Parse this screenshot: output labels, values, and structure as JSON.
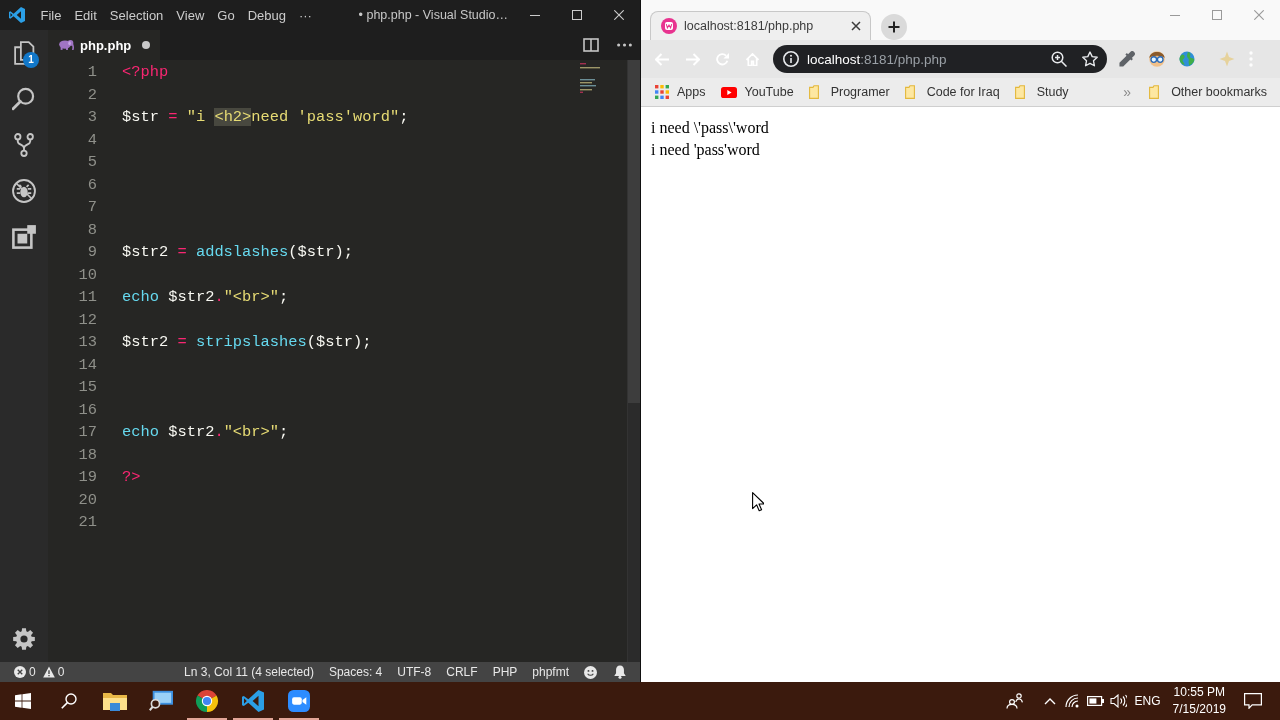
{
  "editor": {
    "title": "• php.php - Visual Studio…",
    "menu": [
      "File",
      "Edit",
      "Selection",
      "View",
      "Go",
      "Debug",
      "···"
    ],
    "explorer_badge": "1",
    "tab": {
      "label": "php.php",
      "modified": true
    },
    "lines": [
      {
        "number": "1",
        "tokens": [
          {
            "kind": "tag",
            "text": "<?php",
            "selected": false
          }
        ]
      },
      {
        "number": "2"
      },
      {
        "number": "3",
        "tokens": [
          {
            "kind": "variable",
            "text": "$str",
            "selected": false
          },
          {
            "kind": "operator",
            "text": " = ",
            "selected": false
          },
          {
            "kind": "string",
            "text": "\"i ",
            "selected": false
          },
          {
            "kind": "string",
            "text": "<h2>",
            "selected": true
          },
          {
            "kind": "string",
            "text": "need 'pass'word\"",
            "selected": false
          },
          {
            "kind": "punctuation",
            "text": ";",
            "selected": false
          }
        ]
      },
      {
        "number": "4"
      },
      {
        "number": "5"
      },
      {
        "number": "6"
      },
      {
        "number": "7"
      },
      {
        "number": "8"
      },
      {
        "number": "9",
        "tokens": [
          {
            "kind": "variable",
            "text": "$str2",
            "selected": false
          },
          {
            "kind": "operator",
            "text": " = ",
            "selected": false
          },
          {
            "kind": "function",
            "text": "addslashes",
            "selected": false
          },
          {
            "kind": "punctuation",
            "text": "($str);",
            "selected": false
          }
        ]
      },
      {
        "number": "10"
      },
      {
        "number": "11",
        "tokens": [
          {
            "kind": "keyword",
            "text": "echo",
            "selected": false
          },
          {
            "kind": "variable",
            "text": " $str2",
            "selected": false
          },
          {
            "kind": "operator",
            "text": ".",
            "selected": false
          },
          {
            "kind": "string",
            "text": "\"<br>\"",
            "selected": false
          },
          {
            "kind": "punctuation",
            "text": ";",
            "selected": false
          }
        ]
      },
      {
        "number": "12"
      },
      {
        "number": "13",
        "tokens": [
          {
            "kind": "variable",
            "text": "$str2",
            "selected": false
          },
          {
            "kind": "operator",
            "text": " = ",
            "selected": false
          },
          {
            "kind": "function",
            "text": "stripslashes",
            "selected": false
          },
          {
            "kind": "punctuation",
            "text": "($str);",
            "selected": false
          }
        ]
      },
      {
        "number": "14"
      },
      {
        "number": "15"
      },
      {
        "number": "16"
      },
      {
        "number": "17",
        "tokens": [
          {
            "kind": "keyword",
            "text": "echo",
            "selected": false
          },
          {
            "kind": "variable",
            "text": " $str2",
            "selected": false
          },
          {
            "kind": "operator",
            "text": ".",
            "selected": false
          },
          {
            "kind": "string",
            "text": "\"<br>\"",
            "selected": false
          },
          {
            "kind": "punctuation",
            "text": ";",
            "selected": false
          }
        ]
      },
      {
        "number": "18"
      },
      {
        "number": "19",
        "tokens": [
          {
            "kind": "tag",
            "text": "?>",
            "selected": false
          }
        ]
      },
      {
        "number": "20"
      },
      {
        "number": "21"
      }
    ],
    "status_bar": {
      "errors": "0",
      "warnings": "0",
      "items": [
        "Ln 3, Col 11 (4 selected)",
        "Spaces: 4",
        "UTF-8",
        "CRLF",
        "PHP",
        "phpfmt"
      ]
    }
  },
  "browser": {
    "tab": {
      "title": "localhost:8181/php.php"
    },
    "address": {
      "host": "localhost",
      "rest": ":8181/php.php"
    },
    "bookmarks": [
      {
        "kind": "apps",
        "label": "Apps"
      },
      {
        "kind": "youtube",
        "label": "YouTube"
      },
      {
        "kind": "folder",
        "label": "Programer"
      },
      {
        "kind": "folder",
        "label": "Code for Iraq"
      },
      {
        "kind": "folder",
        "label": "Study"
      }
    ],
    "overflow": "»",
    "other_bookmarks": "Other bookmarks",
    "page_lines": [
      "i need \\'pass\\'word",
      "i need 'pass'word"
    ]
  },
  "taskbar": {
    "apps": [
      {
        "kind": "file-explorer",
        "running": false
      },
      {
        "kind": "remote-desktop",
        "running": false
      },
      {
        "kind": "chrome",
        "running": true
      },
      {
        "kind": "vscode",
        "running": true
      },
      {
        "kind": "zoom",
        "running": true
      }
    ],
    "language": "ENG",
    "time": "10:55 PM",
    "date": "7/15/2019"
  }
}
